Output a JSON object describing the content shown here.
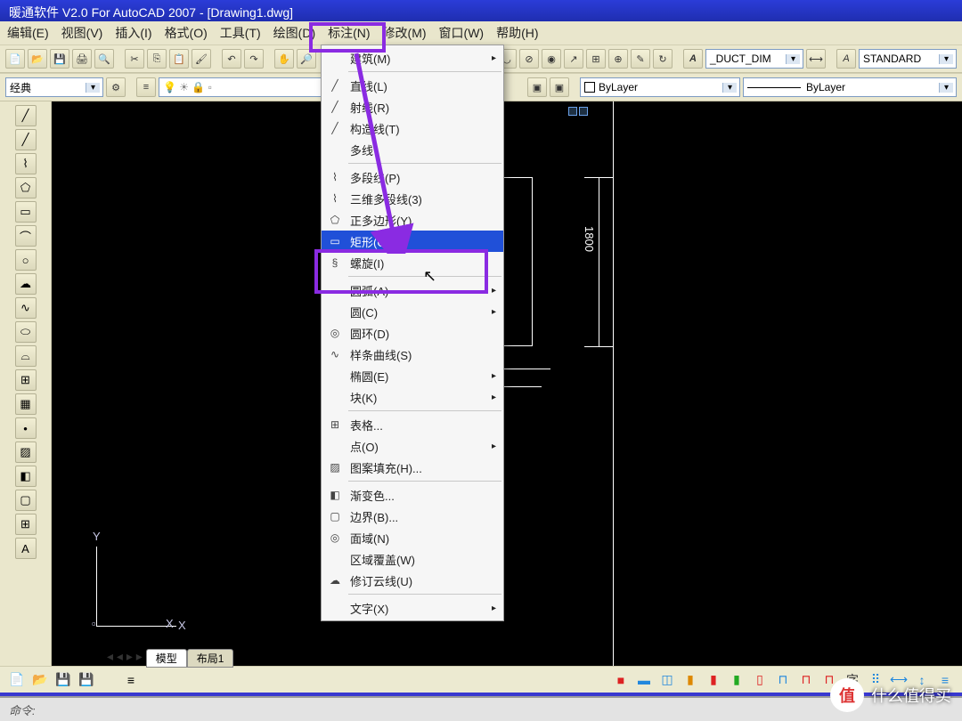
{
  "title": "暖通软件 V2.0 For AutoCAD 2007 - [Drawing1.dwg]",
  "menubar": {
    "edit": "编辑(E)",
    "view": "视图(V)",
    "insert": "插入(I)",
    "format": "格式(O)",
    "tools": "工具(T)",
    "draw": "绘图(D)",
    "dim": "标注(N)",
    "modify": "修改(M)",
    "window": "窗口(W)",
    "help": "帮助(H)"
  },
  "toolbar1": {
    "workspace": "经典"
  },
  "toolbar_right": {
    "dimstyle": "_DUCT_DIM",
    "textstyle": "STANDARD"
  },
  "prop_row": {
    "color": "ByLayer",
    "linetype": "ByLayer"
  },
  "draw_menu": {
    "modeling": "建筑(M)",
    "line": "直线(L)",
    "ray": "射线(R)",
    "xline": "构造线(T)",
    "mline": "多线",
    "pline": "多段线(P)",
    "3dpoly": "三维多段线(3)",
    "polygon": "正多边形(Y)",
    "rect": "矩形(G)",
    "helix": "螺旋(I)",
    "arc": "圆弧(A)",
    "circle": "圆(C)",
    "donut": "圆环(D)",
    "spline": "样条曲线(S)",
    "ellipse": "椭圆(E)",
    "block": "块(K)",
    "table": "表格...",
    "point": "点(O)",
    "hatch": "图案填充(H)...",
    "gradient": "渐变色...",
    "boundary": "边界(B)...",
    "region": "面域(N)",
    "wipeout": "区域覆盖(W)",
    "revcloud": "修订云线(U)",
    "text": "文字(X)"
  },
  "tabs": {
    "model": "模型",
    "layout1": "布局1"
  },
  "canvas": {
    "dim_value": "1800",
    "ucs_y": "Y",
    "ucs_x": "X"
  },
  "watermark": {
    "badge": "值",
    "text": "什么值得买"
  },
  "command": "命令:"
}
